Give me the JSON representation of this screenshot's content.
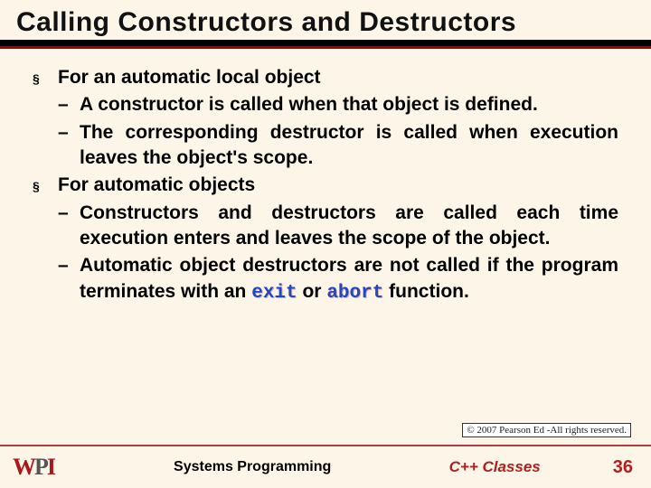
{
  "title": "Calling Constructors and Destructors",
  "bullets": [
    {
      "text": "For an automatic local object",
      "subs": [
        "A constructor is called when that object is defined.",
        "The corresponding destructor is called when execution leaves the object's scope."
      ]
    },
    {
      "text": "For automatic objects",
      "subs": [
        "Constructors and destructors are called each time execution enters and leaves the scope of the object.",
        "Automatic object destructors are not called if the program terminates with an <kw>exit</kw> or <kw>abort</kw> function."
      ]
    }
  ],
  "copyright": "© 2007 Pearson Ed -All rights reserved.",
  "footer": {
    "course": "Systems Programming",
    "topic": "C++ Classes",
    "page": "36",
    "logo": {
      "w": "W",
      "p": "P",
      "i": "I"
    }
  }
}
